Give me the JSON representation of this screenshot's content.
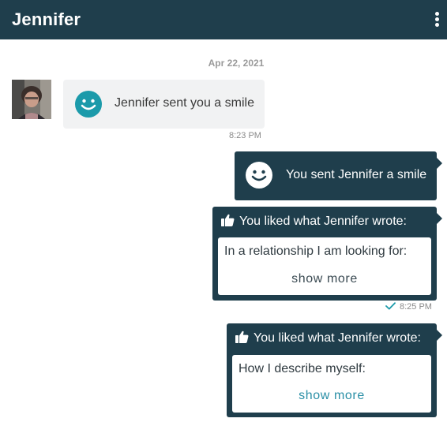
{
  "header": {
    "title": "Jennifer",
    "menu_icon": "kebab-menu-icon"
  },
  "conversation": {
    "date": "Apr 22, 2021",
    "messages": [
      {
        "direction": "incoming",
        "type": "smile",
        "icon": "smile-icon",
        "text": "Jennifer sent you a smile",
        "time": "8:23 PM"
      },
      {
        "direction": "outgoing",
        "type": "smile",
        "icon": "smile-icon",
        "text": "You sent Jennifer a smile"
      },
      {
        "direction": "outgoing",
        "type": "like",
        "icon": "thumbs-up-icon",
        "heading": "You liked what Jennifer wrote:",
        "quote": "In a relationship I am looking for:",
        "show_more": "show more",
        "time": "8:25 PM",
        "status_icon": "checkmark-icon"
      },
      {
        "direction": "outgoing",
        "type": "like",
        "icon": "thumbs-up-icon",
        "heading": "You liked what Jennifer wrote:",
        "quote": "How I describe myself:",
        "show_more": "show more"
      }
    ]
  },
  "colors": {
    "header_bg": "#1f3e4c",
    "outgoing_bubble": "#1f3e4c",
    "incoming_bubble": "#f1f2f3",
    "accent_teal": "#1b9aaa",
    "link_teal": "#2a8fa6"
  }
}
